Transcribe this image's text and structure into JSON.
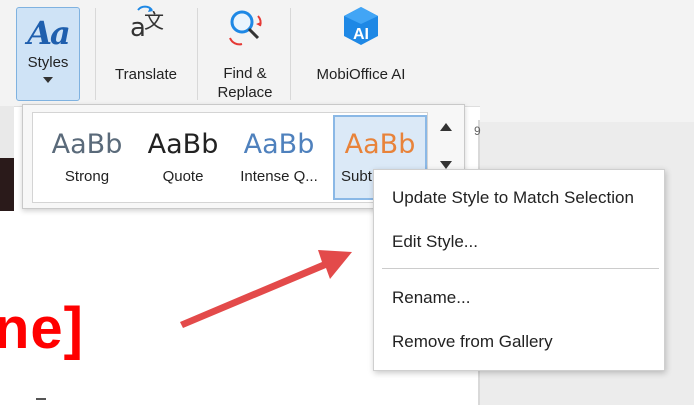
{
  "toolbar": {
    "styles_label": "Styles",
    "translate_label": "Translate",
    "find_replace_label_line1": "Find &",
    "find_replace_label_line2": "Replace",
    "mobioffice_label": "MobiOffice AI",
    "ai_badge_text": "AI",
    "styles_icon_text": "Aa",
    "translate_icon": "translate-icon",
    "find_icon": "find-replace-icon"
  },
  "ruler": {
    "number": "9"
  },
  "document": {
    "visible_text": "ne]"
  },
  "gallery": {
    "tiles": [
      {
        "sample": "AaBb",
        "name": "Strong",
        "color": "#5a6a7a"
      },
      {
        "sample": "AaBb",
        "name": "Quote",
        "color": "#222222"
      },
      {
        "sample": "AaBb",
        "name": "Intense Q...",
        "color": "#4f81bd"
      },
      {
        "sample": "AaBb",
        "name": "Subt",
        "color": "#e8833a"
      }
    ]
  },
  "context_menu": {
    "items": [
      "Update Style to Match Selection",
      "Edit Style...",
      "Rename...",
      "Remove from Gallery"
    ]
  },
  "colors": {
    "accent": "#cfe3f6",
    "red": "#ff0000",
    "arrow": "#e34a4a",
    "ai_badge": "#1e88e5"
  }
}
